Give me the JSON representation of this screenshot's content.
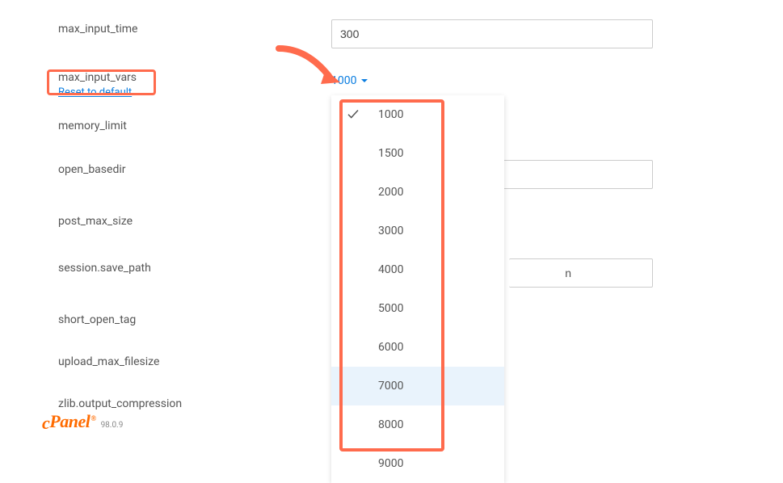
{
  "rows": {
    "max_input_time": {
      "label": "max_input_time",
      "value": "300"
    },
    "max_input_vars": {
      "label": "max_input_vars",
      "trigger": "1000",
      "reset": "Reset to default"
    },
    "memory_limit": {
      "label": "memory_limit"
    },
    "open_basedir": {
      "label": "open_basedir",
      "value": ""
    },
    "post_max_size": {
      "label": "post_max_size"
    },
    "session_save_path": {
      "label": "session.save_path",
      "value_suffix": "n"
    },
    "short_open_tag": {
      "label": "short_open_tag"
    },
    "upload_max_filesize": {
      "label": "upload_max_filesize"
    },
    "zlib_output_compression": {
      "label": "zlib.output_compression"
    }
  },
  "dropdown": {
    "options": [
      "1000",
      "1500",
      "2000",
      "3000",
      "4000",
      "5000",
      "6000",
      "7000",
      "8000",
      "9000"
    ],
    "selected": "1000",
    "hovered": "7000"
  },
  "footer": {
    "brand": "cPanel",
    "version": "98.0.9"
  },
  "annotations": {
    "arrow_color": "#ff6b4d",
    "highlight_color": "#ff6b4d"
  }
}
